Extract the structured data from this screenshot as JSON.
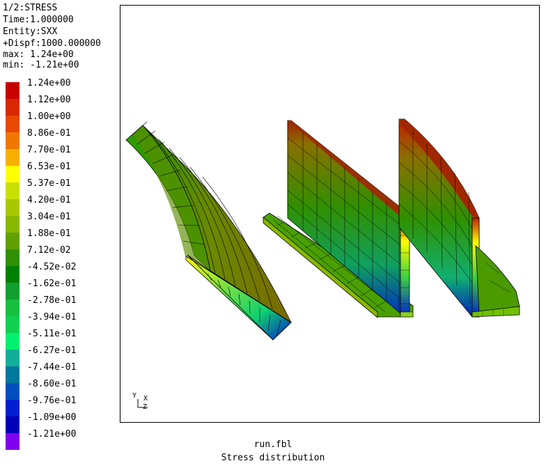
{
  "header": {
    "line1": "1/2:STRESS",
    "line2": "Time:1.000000",
    "line3": "Entity:SXX",
    "line4": "+Dispf:1000.000000",
    "line5": "max: 1.24e+00",
    "line6": "min: -1.21e+00"
  },
  "legend": {
    "labels": [
      "1.24e+00",
      "1.12e+00",
      "1.00e+00",
      "8.86e-01",
      "7.70e-01",
      "6.53e-01",
      "5.37e-01",
      "4.20e-01",
      "3.04e-01",
      "1.88e-01",
      "7.12e-02",
      "-4.52e-02",
      "-1.62e-01",
      "-2.78e-01",
      "-3.94e-01",
      "-5.11e-01",
      "-6.27e-01",
      "-7.44e-01",
      "-8.60e-01",
      "-9.76e-01",
      "-1.09e+00",
      "-1.21e+00"
    ],
    "colors": [
      "#c80000",
      "#d82800",
      "#e84800",
      "#f07800",
      "#f8b000",
      "#ffff00",
      "#c8e000",
      "#a8c800",
      "#88b800",
      "#60a000",
      "#309000",
      "#008000",
      "#10a030",
      "#18c040",
      "#10d050",
      "#00f070",
      "#10b098",
      "#00789c",
      "#0050c0",
      "#0020d0",
      "#0000b8",
      "#8000f0"
    ]
  },
  "axis_triad": {
    "y": "Y",
    "x": "X",
    "z": "Z"
  },
  "footer": {
    "filename": "run.fbl",
    "caption": "Stress distribution"
  }
}
